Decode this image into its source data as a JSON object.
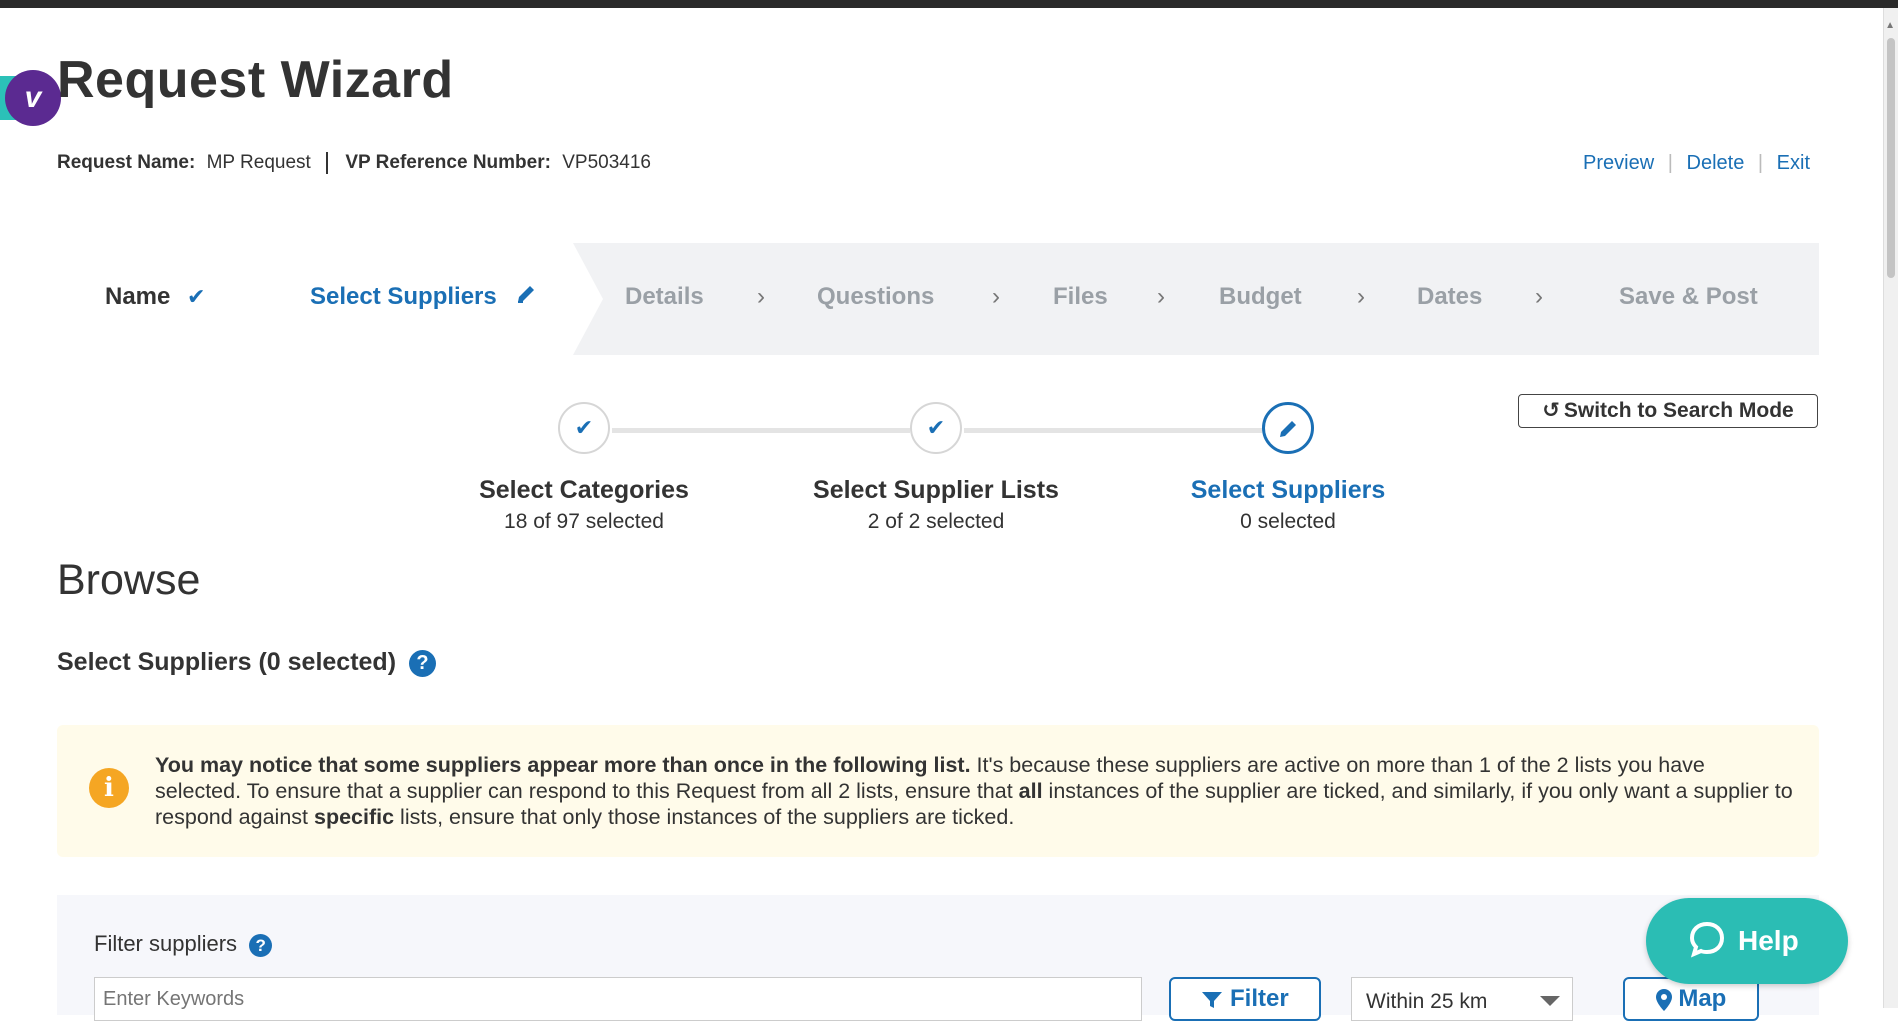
{
  "header": {
    "title": "Request Wizard",
    "request_name_label": "Request Name:",
    "request_name_value": "MP Request",
    "vp_ref_label": "VP Reference Number:",
    "vp_ref_value": "VP503416",
    "links": {
      "preview": "Preview",
      "delete": "Delete",
      "exit": "Exit"
    }
  },
  "steps": [
    {
      "label": "Name",
      "state": "done"
    },
    {
      "label": "Select Suppliers",
      "state": "active"
    },
    {
      "label": "Details",
      "state": "todo"
    },
    {
      "label": "Questions",
      "state": "todo"
    },
    {
      "label": "Files",
      "state": "todo"
    },
    {
      "label": "Budget",
      "state": "todo"
    },
    {
      "label": "Dates",
      "state": "todo"
    },
    {
      "label": "Save & Post",
      "state": "todo"
    }
  ],
  "substeps": [
    {
      "title": "Select Categories",
      "count": "18 of 97 selected",
      "state": "done"
    },
    {
      "title": "Select Supplier Lists",
      "count": "2 of 2 selected",
      "state": "done"
    },
    {
      "title": "Select Suppliers",
      "count": "0 selected",
      "state": "active"
    }
  ],
  "switch_mode_label": "Switch to Search Mode",
  "browse": {
    "title": "Browse",
    "section_title": "Select Suppliers (0 selected)",
    "notice": {
      "bold_lead": "You may notice that some suppliers appear more than once in the following list.",
      "text_1": " It's because these suppliers are active on more than 1 of the 2 lists you have selected. To ensure that a supplier can respond to this Request from all 2 lists, ensure that ",
      "bold_all": "all",
      "text_2": " instances of the supplier are ticked, and similarly, if you only want a supplier to respond against ",
      "bold_specific": "specific",
      "text_3": " lists, ensure that only those instances of the suppliers are ticked."
    }
  },
  "filter": {
    "label": "Filter suppliers",
    "keywords_placeholder": "Enter Keywords",
    "filter_button": "Filter",
    "distance_value": "Within 25 km",
    "map_button": "Map"
  },
  "help_widget": {
    "label": "Help"
  },
  "colors": {
    "accent": "#1a6fb5",
    "teal": "#2bbdb4",
    "notice_bg": "#fffbea",
    "warn": "#f5a623",
    "brand_purple": "#5b2a91"
  }
}
